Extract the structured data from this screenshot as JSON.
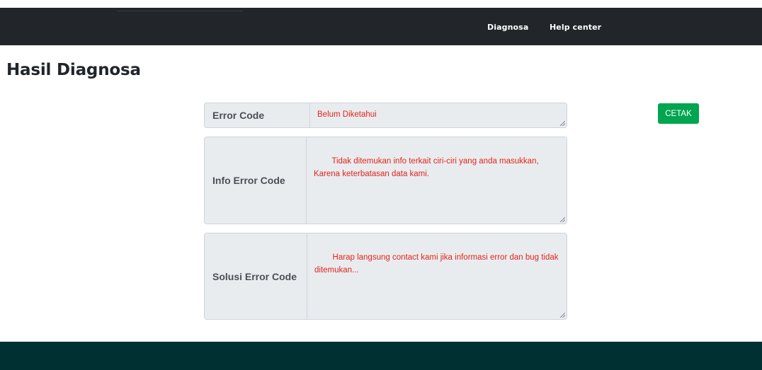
{
  "navbar": {
    "links": [
      {
        "label": "Diagnosa"
      },
      {
        "label": "Help center"
      }
    ]
  },
  "page": {
    "title": "Hasil Diagnosa"
  },
  "result": {
    "error_code": {
      "label": "Error Code",
      "value": "Belum Diketahui"
    },
    "info_error_code": {
      "label": "Info Error Code",
      "value": "    Tidak ditemukan info terkait ciri-ciri yang anda masukkan, Karena keterbatasan data kami."
    },
    "solusi_error_code": {
      "label": "Solusi Error Code",
      "value": "    Harap langsung contact kami jika informasi error dan bug tidak ditemukan..."
    }
  },
  "actions": {
    "print_label": "CETAK"
  },
  "colors": {
    "navbar_bg": "#222529",
    "field_text": "#e3241b",
    "print_button": "#00a550",
    "footer_bg": "#003032"
  }
}
